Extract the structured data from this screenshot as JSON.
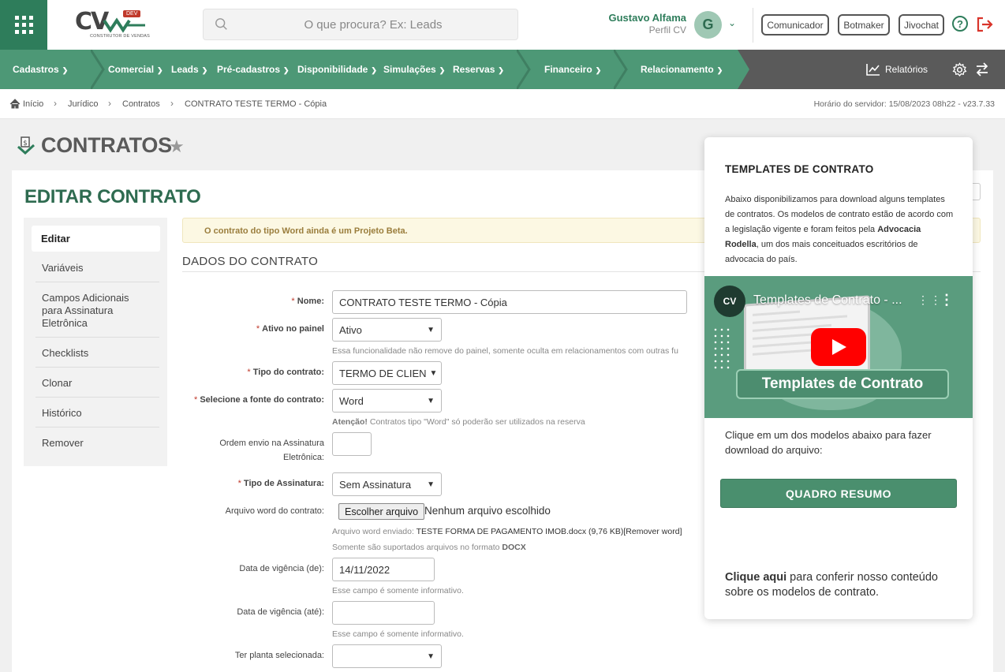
{
  "topbar": {
    "logo": "CV",
    "logo_badge": "DEV",
    "logo_sub": "CONSTRUTOR DE VENDAS",
    "search_placeholder": "O que procura? Ex: Leads",
    "user_name": "Gustavo Alfama",
    "user_profile": "Perfil CV",
    "avatar_letter": "G",
    "buttons": [
      "Comunicador",
      "Botmaker",
      "Jivochat"
    ],
    "help_label": "?"
  },
  "nav": {
    "items": [
      "Cadastros",
      "Comercial",
      "Leads",
      "Pré-cadastros",
      "Disponibilidade",
      "Simulações",
      "Reservas",
      "Financeiro",
      "Relacionamento"
    ],
    "reports": "Relatórios"
  },
  "breadcrumb": {
    "items": [
      "Início",
      "Jurídico",
      "Contratos",
      "CONTRATO TESTE TERMO - Cópia"
    ],
    "server_time": "Horário do servidor: 15/08/2023 08h22 - v23.7.33"
  },
  "page": {
    "title": "CONTRATOS",
    "edit_title": "EDITAR CONTRATO"
  },
  "sidemenu": {
    "items": [
      "Editar",
      "Variáveis",
      "Campos Adicionais para Assinatura Eletrônica",
      "Checklists",
      "Clonar",
      "Histórico",
      "Remover"
    ]
  },
  "form": {
    "beta_alert": "O contrato do tipo Word ainda é um Projeto Beta.",
    "section_title": "DADOS DO CONTRATO",
    "nome_label": "Nome:",
    "nome_value": "CONTRATO TESTE TERMO - Cópia",
    "ativo_label": "Ativo no painel",
    "ativo_value": "Ativo",
    "ativo_hint": "Essa funcionalidade não remove do painel, somente oculta em relacionamentos com outras fu",
    "tipo_label": "Tipo do contrato:",
    "tipo_value": "TERMO DE CLIEN",
    "fonte_label": "Selecione a fonte do contrato:",
    "fonte_value": "Word",
    "fonte_hint_bold": "Atenção!",
    "fonte_hint": " Contratos tipo \"Word\" só poderão ser utilizados na reserva",
    "ordem_label_1": "Ordem envio na Assinatura",
    "ordem_label_2": "Eletrônica:",
    "assinatura_label": "Tipo de Assinatura:",
    "assinatura_value": "Sem Assinatura",
    "arquivo_label": "Arquivo word do contrato:",
    "file_button": "Escolher arquivo",
    "file_status": "Nenhum arquivo escolhido",
    "arquivo_enviado_label": "Arquivo word enviado: ",
    "arquivo_enviado": "TESTE FORMA DE PAGAMENTO IMOB.docx (9,76 KB)[Remover word]",
    "formato_hint": "Somente são suportados arquivos no formato ",
    "formato_bold": "DOCX",
    "vig_de_label": "Data de vigência (de):",
    "vig_de_value": "14/11/2022",
    "vig_hint": "Esse campo é somente informativo.",
    "vig_ate_label": "Data de vigência (até):",
    "planta_label": "Ter planta selecionada:"
  },
  "popup": {
    "title": "TEMPLATES DE CONTRATO",
    "desc_1": "Abaixo disponibilizamos para download alguns templates de contratos. Os modelos de contrato estão de acordo com a legislação vigente e foram feitos pela ",
    "desc_bold": "Advocacia Rodella",
    "desc_2": ", um dos mais conceituados escritórios de advocacia do país.",
    "video_title": "Templates de Contrato - ...",
    "video_logo": "CV",
    "video_banner": "Templates de Contrato",
    "click_text": "Clique em um dos modelos abaixo para fazer download do arquivo:",
    "button": "QUADRO RESUMO",
    "footer_bold": "Clique aqui",
    "footer_text": " para conferir nosso conteúdo sobre os modelos de contrato."
  }
}
